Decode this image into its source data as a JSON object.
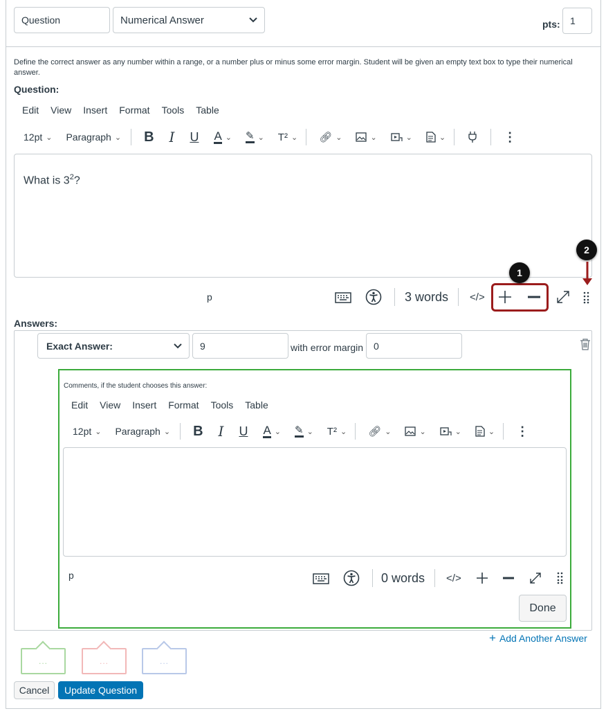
{
  "header": {
    "question_name": "Question",
    "question_type": "Numerical Answer",
    "pts_label": "pts:",
    "pts_value": "1"
  },
  "description": "Define the correct answer as any number within a range, or a number plus or minus some error margin. Student will be given an empty text box to type their numerical answer.",
  "question_label": "Question:",
  "menu": [
    "Edit",
    "View",
    "Insert",
    "Format",
    "Tools",
    "Table"
  ],
  "toolbar": {
    "font_size": "12pt",
    "block": "Paragraph"
  },
  "question_editor": {
    "text_prefix": "What is 3",
    "superscript": "2",
    "text_suffix": "?",
    "status_path": "p",
    "word_count": "3 words"
  },
  "callouts": {
    "one": "1",
    "two": "2"
  },
  "answers": {
    "label": "Answers:",
    "answer_type": "Exact Answer:",
    "value": "9",
    "error_margin_label": "with error margin",
    "error_margin": "0",
    "comments_label": "Comments, if the student chooses this answer:",
    "status_path": "p",
    "word_count": "0 words",
    "done_label": "Done",
    "add_another": "Add Another Answer"
  },
  "bubbles": {
    "placeholder": "..."
  },
  "footer": {
    "cancel": "Cancel",
    "update": "Update Question"
  },
  "colors": {
    "accent": "#0374b5",
    "highlight": "#9b1c1c",
    "comment_border": "#3bab3b",
    "bubble_green": "#a9d8a0",
    "bubble_red": "#f2b8b8",
    "bubble_blue": "#b8c8e8"
  }
}
